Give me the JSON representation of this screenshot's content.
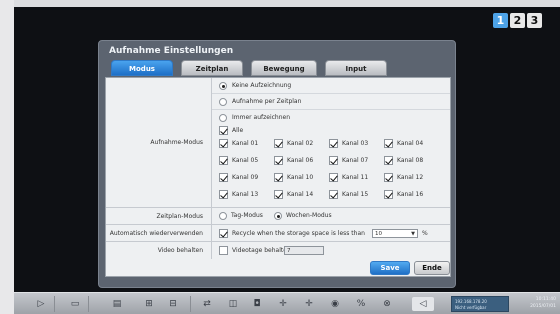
{
  "pages": [
    "1",
    "2",
    "3"
  ],
  "dialog": {
    "title": "Aufnahme Einstellungen",
    "tabs": [
      "Modus",
      "Zeitplan",
      "Bewegung",
      "Input"
    ],
    "active_tab": "Modus"
  },
  "recording_mode": {
    "label": "Aufnahme-Modus",
    "options": [
      "Keine Aufzeichnung",
      "Aufnahme per Zeitplan",
      "Immer aufzeichnen"
    ],
    "selected_option": "Keine Aufzeichnung",
    "all_label": "Alle",
    "all_checked": true,
    "channels": [
      {
        "label": "Kanal 01",
        "checked": true
      },
      {
        "label": "Kanal 02",
        "checked": true
      },
      {
        "label": "Kanal 03",
        "checked": true
      },
      {
        "label": "Kanal 04",
        "checked": true
      },
      {
        "label": "Kanal 05",
        "checked": true
      },
      {
        "label": "Kanal 06",
        "checked": true
      },
      {
        "label": "Kanal 07",
        "checked": true
      },
      {
        "label": "Kanal 08",
        "checked": true
      },
      {
        "label": "Kanal 09",
        "checked": true
      },
      {
        "label": "Kanal 10",
        "checked": true
      },
      {
        "label": "Kanal 11",
        "checked": true
      },
      {
        "label": "Kanal 12",
        "checked": true
      },
      {
        "label": "Kanal 13",
        "checked": true
      },
      {
        "label": "Kanal 14",
        "checked": true
      },
      {
        "label": "Kanal 15",
        "checked": true
      },
      {
        "label": "Kanal 16",
        "checked": true
      }
    ]
  },
  "schedule_mode": {
    "label": "Zeitplan-Modus",
    "options": [
      "Tag-Modus",
      "Wochen-Modus"
    ],
    "selected_option": "Wochen-Modus"
  },
  "overwrite": {
    "label": "Automatisch wiederverwenden",
    "checked": true,
    "text": "Recycle when the storage space is less than",
    "value": "10",
    "unit": "%"
  },
  "keep_video": {
    "label": "Video behalten",
    "checked": false,
    "text": "Videotage behalten",
    "value": "7"
  },
  "buttons": {
    "save": "Save",
    "end": "Ende"
  },
  "taskbar": {
    "status_line1": "192.168.178.20",
    "status_line2": "Nicht verfügbar",
    "time": "10:11:40",
    "date": "2015/07/01"
  },
  "colors": {
    "accent": "#1f70c6",
    "active_page": "#4da3e8",
    "dialog_bg": "#5c6470",
    "content_bg": "#eef0f2"
  }
}
